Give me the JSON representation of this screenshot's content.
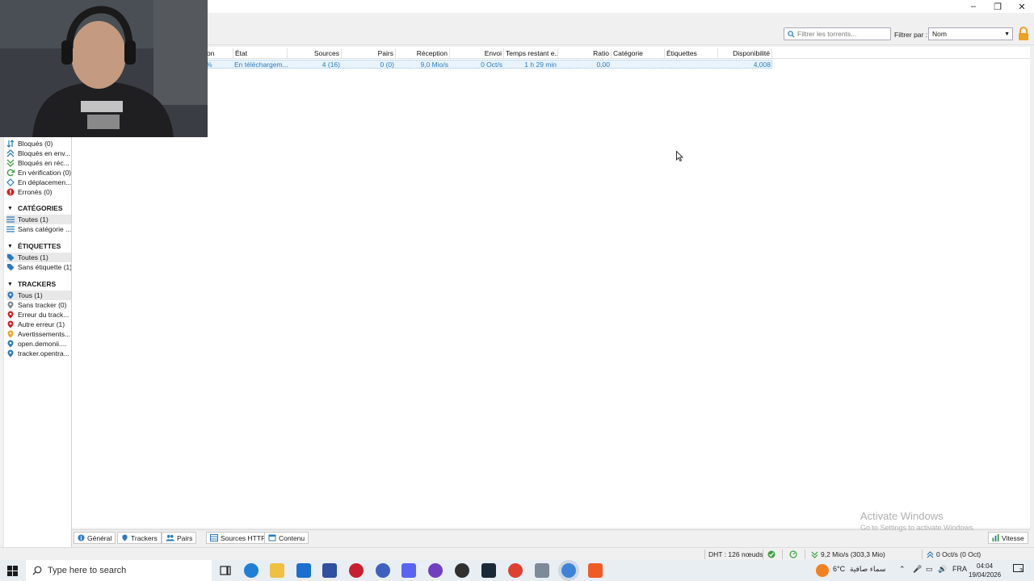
{
  "toolbar": {
    "search_placeholder": "Filtrer les torrents...",
    "filter_label": "Filtrer par :",
    "filter_value": "Nom"
  },
  "sidebar": {
    "status_items": [
      {
        "label": "Bloqués (0)"
      },
      {
        "label": "Bloqués en env..."
      },
      {
        "label": "Bloqués en réc..."
      },
      {
        "label": "En vérification (0)"
      },
      {
        "label": "En déplacemen..."
      },
      {
        "label": "Erronés (0)"
      }
    ],
    "categories_header": "CATÉGORIES",
    "categories": [
      {
        "label": "Toutes (1)"
      },
      {
        "label": "Sans catégorie ..."
      }
    ],
    "tags_header": "ÉTIQUETTES",
    "tags": [
      {
        "label": "Toutes (1)"
      },
      {
        "label": "Sans étiquette (1)"
      }
    ],
    "trackers_header": "TRACKERS",
    "trackers": [
      {
        "label": "Tous (1)"
      },
      {
        "label": "Sans tracker (0)"
      },
      {
        "label": "Erreur du track..."
      },
      {
        "label": "Autre erreur (1)"
      },
      {
        "label": "Avertissements..."
      },
      {
        "label": "open.demonii...."
      },
      {
        "label": "tracker.opentra..."
      }
    ]
  },
  "table": {
    "columns": [
      "on",
      "État",
      "Sources",
      "Pairs",
      "Réception",
      "Envoi",
      "Temps restant e...",
      "Ratio",
      "Catégorie",
      "Étiquettes",
      "Disponibilité"
    ],
    "rows": [
      {
        "progress": "%",
        "state": "En téléchargem...",
        "sources": "4 (16)",
        "peers": "0 (0)",
        "download": "9,0 Mio/s",
        "upload": "0 Oct/s",
        "eta": "1 h 29 min",
        "ratio": "0,00",
        "category": "",
        "tags": "",
        "availability": "4,008"
      }
    ]
  },
  "bottom_tabs": [
    "Général",
    "Trackers",
    "Pairs",
    "Sources HTTP",
    "Contenu"
  ],
  "speed_button": "Vitesse",
  "watermark": {
    "line1": "Activate Windows",
    "line2": "Go to Settings to activate Windows."
  },
  "statusbar": {
    "dht": "DHT : 126 nœuds",
    "download": "9,2 Mio/s (303,3 Mio)",
    "upload": "0 Oct/s (0 Oct)"
  },
  "taskbar": {
    "search_placeholder": "Type here to search",
    "weather_temp": "6°C",
    "weather_text": "سماء صافية",
    "language": "FRA",
    "time": "04:04",
    "date": "19/04/2026",
    "notification_count": "3"
  },
  "colors": {
    "accent": "#2a7bbf",
    "row_highlight": "#e9f3fb",
    "error_red": "#d32020",
    "lock_orange": "#f0a020"
  }
}
